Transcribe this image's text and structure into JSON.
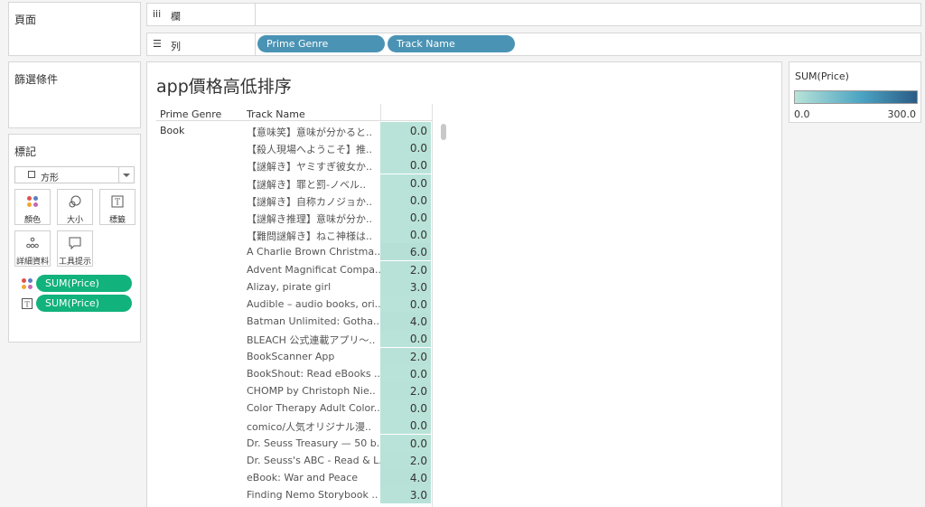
{
  "left_panels": {
    "pages_title": "頁面",
    "filters_title": "篩選條件",
    "marks_title": "標記",
    "mark_type": "方形",
    "mark_buttons": [
      "顏色",
      "大小",
      "標籤",
      "詳細資料",
      "工具提示"
    ],
    "mark_pills": [
      "SUM(Price)",
      "SUM(Price)"
    ]
  },
  "shelves": {
    "columns_label": "欄",
    "rows_label": "列",
    "rows_pills": [
      "Prime Genre",
      "Track Name"
    ]
  },
  "viz": {
    "title": "app價格高低排序",
    "col_headers": [
      "Prime Genre",
      "Track Name"
    ],
    "genre": "Book",
    "rows": [
      {
        "name": "【意味笑】意味が分かると..",
        "value": "0.0",
        "price": 0
      },
      {
        "name": "【殺人現場へようこそ】推..",
        "value": "0.0",
        "price": 0
      },
      {
        "name": "【謎解き】ヤミすぎ彼女か..",
        "value": "0.0",
        "price": 0
      },
      {
        "name": "【謎解き】罪と罰-ノベル..",
        "value": "0.0",
        "price": 0
      },
      {
        "name": "【謎解き】自称カノジョか..",
        "value": "0.0",
        "price": 0
      },
      {
        "name": "【謎解き推理】意味が分か..",
        "value": "0.0",
        "price": 0
      },
      {
        "name": "【難問謎解き】ねこ神様は..",
        "value": "0.0",
        "price": 0
      },
      {
        "name": "A Charlie Brown Christma..",
        "value": "6.0",
        "price": 6
      },
      {
        "name": "Advent Magnificat Compa..",
        "value": "2.0",
        "price": 2
      },
      {
        "name": "Alizay, pirate girl",
        "value": "3.0",
        "price": 3
      },
      {
        "name": "Audible – audio books, ori..",
        "value": "0.0",
        "price": 0
      },
      {
        "name": "Batman Unlimited: Gotha..",
        "value": "4.0",
        "price": 4
      },
      {
        "name": "BLEACH 公式連載アプリ～..",
        "value": "0.0",
        "price": 0
      },
      {
        "name": "BookScanner App",
        "value": "2.0",
        "price": 2
      },
      {
        "name": "BookShout: Read eBooks ..",
        "value": "0.0",
        "price": 0
      },
      {
        "name": "CHOMP by Christoph Nie..",
        "value": "2.0",
        "price": 2
      },
      {
        "name": "Color Therapy Adult Color..",
        "value": "0.0",
        "price": 0
      },
      {
        "name": "comico/人気オリジナル漫..",
        "value": "0.0",
        "price": 0
      },
      {
        "name": "Dr. Seuss Treasury — 50 b..",
        "value": "0.0",
        "price": 0
      },
      {
        "name": "Dr. Seuss's ABC - Read & L..",
        "value": "2.0",
        "price": 2
      },
      {
        "name": "eBook: War and Peace",
        "value": "4.0",
        "price": 4
      },
      {
        "name": "Finding Nemo Storybook ..",
        "value": "3.0",
        "price": 3
      }
    ]
  },
  "legend": {
    "title": "SUM(Price)",
    "min_label": "0.0",
    "max_label": "300.0",
    "min": 0,
    "max": 300,
    "color_low": "#b9e3d8",
    "color_high": "#2b5b86"
  },
  "colors": {
    "pill_blue": "#4a93b4",
    "pill_green": "#11b27b",
    "cell_low": "#b9e3d8"
  }
}
